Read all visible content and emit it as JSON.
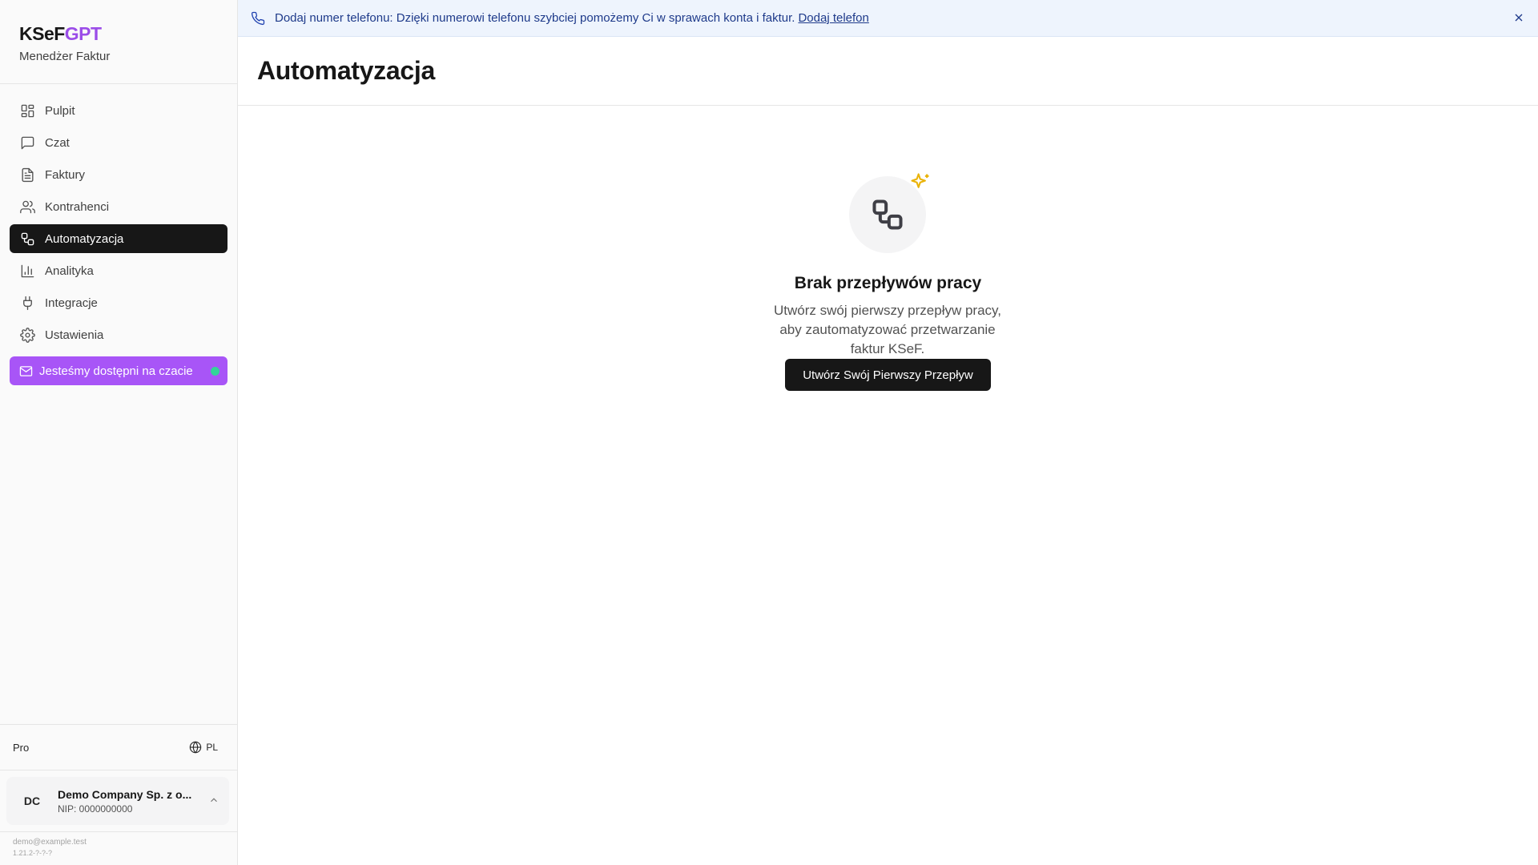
{
  "brand": {
    "title_part1": "KSeF",
    "title_part2": "GPT",
    "subtitle": "Menedżer Faktur",
    "accent_color": "#9b4de8"
  },
  "sidebar": {
    "items": [
      {
        "label": "Pulpit",
        "icon": "dashboard-icon",
        "active": false
      },
      {
        "label": "Czat",
        "icon": "chat-icon",
        "active": false
      },
      {
        "label": "Faktury",
        "icon": "document-icon",
        "active": false
      },
      {
        "label": "Kontrahenci",
        "icon": "users-icon",
        "active": false
      },
      {
        "label": "Automatyzacja",
        "icon": "workflow-icon",
        "active": true
      },
      {
        "label": "Analityka",
        "icon": "bar-chart-icon",
        "active": false
      },
      {
        "label": "Integracje",
        "icon": "plug-icon",
        "active": false
      },
      {
        "label": "Ustawienia",
        "icon": "gear-icon",
        "active": false
      }
    ],
    "chat_cta": {
      "label": "Jesteśmy dostępni na czacie",
      "icon": "mail-icon",
      "color": "#a855f7",
      "status_color": "#34d399"
    },
    "plan": "Pro",
    "language": "PL",
    "company": {
      "initials": "DC",
      "name": "Demo Company Sp. z o...",
      "nip": "NIP: 0000000000"
    },
    "email": "demo@example.test",
    "version": "1.21.2-?-?-?"
  },
  "banner": {
    "text": "Dodaj numer telefonu: Dzięki numerowi telefonu szybciej pomożemy Ci w sprawach konta i faktur.",
    "link": "Dodaj telefon",
    "color": "#1e3a8a"
  },
  "page": {
    "title": "Automatyzacja",
    "empty_state": {
      "title": "Brak przepływów pracy",
      "description": "Utwórz swój pierwszy przepływ pracy, aby zautomatyzować przetwarzanie faktur KSeF.",
      "button": "Utwórz Swój Pierwszy Przepływ",
      "icon": "workflow-icon",
      "sparkle_color": "#eab308"
    }
  }
}
